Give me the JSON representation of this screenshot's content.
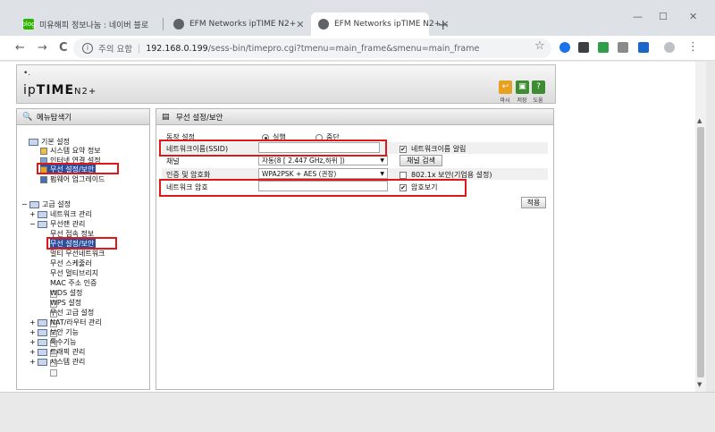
{
  "browser": {
    "tabs": [
      {
        "title": "미유해피 정보나눔 : 네이버 블로",
        "favicon_text": "blog",
        "active": false
      },
      {
        "title": "EFM Networks ipTIME N2+",
        "favicon_text": "",
        "active": false
      },
      {
        "title": "EFM Networks ipTIME N2+",
        "favicon_text": "",
        "active": true
      }
    ],
    "new_tab": "+",
    "window_controls": {
      "minimize": "—",
      "maximize": "☐",
      "close": "✕"
    },
    "nav": {
      "back": "←",
      "forward": "→",
      "reload": "C"
    },
    "address": {
      "security_text": "주의 요함",
      "host": "192.168.0.199",
      "path": "/sess-bin/timepro.cgi?tmenu=main_frame&smenu=main_frame"
    },
    "star": "☆"
  },
  "router": {
    "logo": {
      "dots": "•.",
      "brand_prefix": "ip",
      "brand_bold": "TIME",
      "brand_suffix": "N2+"
    },
    "header_buttons": [
      {
        "glyph": "↩",
        "label": "마시",
        "color": "#e8a020"
      },
      {
        "glyph": "▣",
        "label": "저장",
        "color": "#3d8c32"
      },
      {
        "glyph": "?",
        "label": "도움",
        "color": "#3d8c32"
      }
    ],
    "left_panel": {
      "title": "메뉴탐색기",
      "groups": [
        {
          "label": "기본 설정",
          "items": [
            "시스템 요약 정보",
            "인터넷 연결 설정",
            "무선 설정/보안",
            "펌웨어 업그레이드"
          ]
        },
        {
          "label": "고급 설정",
          "subgroups": [
            {
              "label": "네트워크 관리",
              "toggle": "+"
            },
            {
              "label": "무선랜 관리",
              "toggle": "−",
              "items": [
                "무선 접속 정보",
                "무선 설정/보안",
                "멀티 무선네트워크",
                "무선 스케줄러",
                "무선 멀티브리지",
                "MAC 주소 인증",
                "WDS 설정",
                "WPS 설정",
                "무선 고급 설정"
              ]
            },
            {
              "label": "NAT/라우터 관리",
              "toggle": "+"
            },
            {
              "label": "보안 기능",
              "toggle": "+"
            },
            {
              "label": "특수기능",
              "toggle": "+"
            },
            {
              "label": "트래픽 관리",
              "toggle": "+"
            },
            {
              "label": "시스템 관리",
              "toggle": "+"
            }
          ]
        }
      ]
    },
    "main_panel": {
      "title": "무선 설정/보안",
      "operation_label": "동작 설정",
      "run_label": "실행",
      "stop_label": "중단",
      "ssid_label": "네트워크이름(SSID)",
      "ssid_value": "",
      "ssid_broadcast_label": "네트워크이름 알림",
      "channel_label": "채널",
      "channel_value": "자동(8 [ 2.447 GHz,하위 ])",
      "channel_search_label": "채널 검색",
      "auth_label": "인증 및 암호화",
      "auth_value": "WPA2PSK + AES (권장)",
      "dot1x_label": "802.1x 보안(기업용 설정)",
      "password_label": "네트워크 암호",
      "password_value": "",
      "show_password_label": "암호보기",
      "apply_label": "적용"
    }
  }
}
